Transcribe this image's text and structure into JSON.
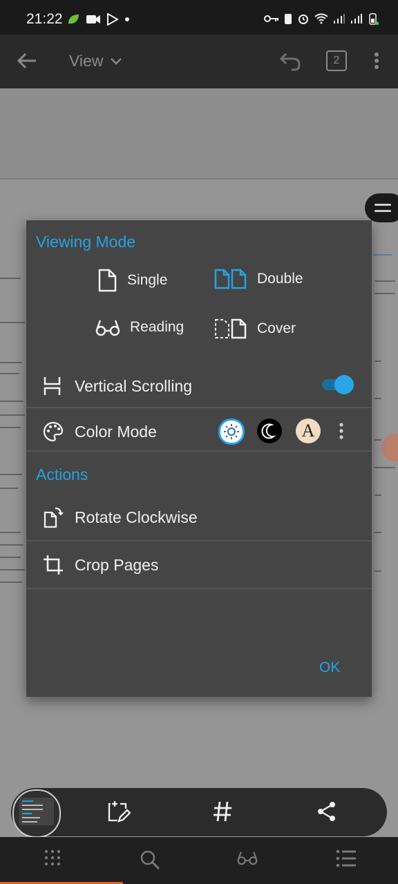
{
  "status_bar": {
    "time": "21:22"
  },
  "app_bar": {
    "title": "View",
    "page_count": "2"
  },
  "dialog": {
    "viewing_mode_title": "Viewing Mode",
    "modes": {
      "single": "Single",
      "double": "Double",
      "reading": "Reading",
      "cover": "Cover"
    },
    "vertical_scrolling_label": "Vertical Scrolling",
    "vertical_scrolling_on": true,
    "color_mode_label": "Color Mode",
    "color_mode_sepia_letter": "A",
    "actions_title": "Actions",
    "rotate_label": "Rotate Clockwise",
    "crop_label": "Crop Pages",
    "ok_label": "OK"
  },
  "colors": {
    "accent": "#24a3e6",
    "dialog_bg": "#454545",
    "app_bar": "#2a2a2a",
    "nav_indicator": "#e06020"
  }
}
